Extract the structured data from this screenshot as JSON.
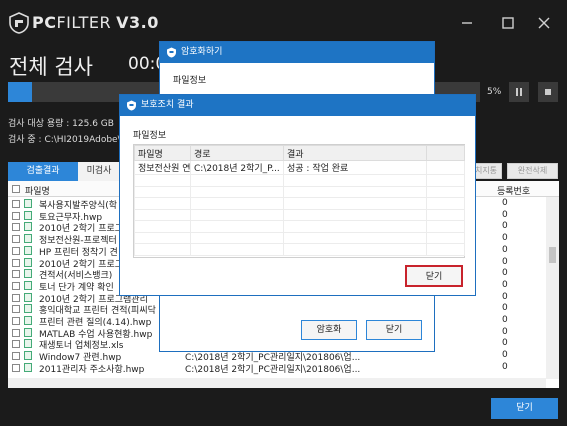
{
  "app": {
    "brand_pc": "PC",
    "brand_filter": "FILTER",
    "version": "V3.0",
    "window_controls": [
      "minimize-icon",
      "maximize-icon",
      "close-icon"
    ]
  },
  "scan": {
    "title": "전체 검사",
    "time": "00:0",
    "progress_percent": 5,
    "progress_label": "5%",
    "pause_icon": "pause-icon",
    "stop_icon": "stop-icon",
    "target_size": "검사 대상 용량 : 125.6 GB",
    "current_path": "검사 중 : C:\\HI2019Adobe\\"
  },
  "tabs": [
    "검출결과",
    "미검사"
  ],
  "actions": [
    "치지통",
    "완전삭제"
  ],
  "list": {
    "header_name": "파일명",
    "header_regno": "등록번호",
    "rows": [
      {
        "name": "복사용지발주양식(학",
        "path": "",
        "num": "0"
      },
      {
        "name": "토요근무자.hwp",
        "path": "",
        "num": "0"
      },
      {
        "name": "2010년 2학기 프로그",
        "path": "",
        "num": "0"
      },
      {
        "name": "정보전산원-프로젝터",
        "path": "",
        "num": "0"
      },
      {
        "name": "HP 프린터 정착기 견",
        "path": "",
        "num": "0"
      },
      {
        "name": "2010년 2학기 프로그",
        "path": "",
        "num": "0"
      },
      {
        "name": "견적서(서비스뱅크)",
        "path": "",
        "num": "0"
      },
      {
        "name": "토너 단가 계약 확인",
        "path": "",
        "num": "0"
      },
      {
        "name": "2010년 2학기 프로그램관리",
        "path": "",
        "num": "0"
      },
      {
        "name": "홍익대학교 프린터 견적(피씨닥",
        "path": "",
        "num": "0"
      },
      {
        "name": "프린터 관련 질의(4.14).hwp",
        "path": "",
        "num": "0"
      },
      {
        "name": "MATLAB 수업 사용현황.hwp",
        "path": "",
        "num": "0"
      },
      {
        "name": "재생토너 업체정보.xls",
        "path": "",
        "num": "0"
      },
      {
        "name": "Window7 관련.hwp",
        "path": "C:\\2018년 2학기_PC관리일지\\201806\\업...",
        "num": "0"
      },
      {
        "name": "2011관리자 주소사항.hwp",
        "path": "C:\\2018년 2학기_PC관리일지\\201806\\업...",
        "num": "0"
      }
    ]
  },
  "main_close_label": "닫기",
  "encrypt_dialog": {
    "title": "암호화하기",
    "section": "파일정보",
    "encrypt_button": "암호화",
    "close_button": "닫기"
  },
  "result_dialog": {
    "title": "보호조치 결과",
    "section": "파일정보",
    "columns": [
      "파일명",
      "경로",
      "결과"
    ],
    "rows": [
      [
        "정보전산원 연락망....",
        "C:\\2018년 2학기_P...",
        "성공 : 작업 완료"
      ]
    ],
    "close_button": "닫기"
  },
  "colors": {
    "accent": "#2d86d8",
    "title_bar": "#1e74c4",
    "highlight": "#c8232c",
    "background": "#1b1b1b"
  }
}
